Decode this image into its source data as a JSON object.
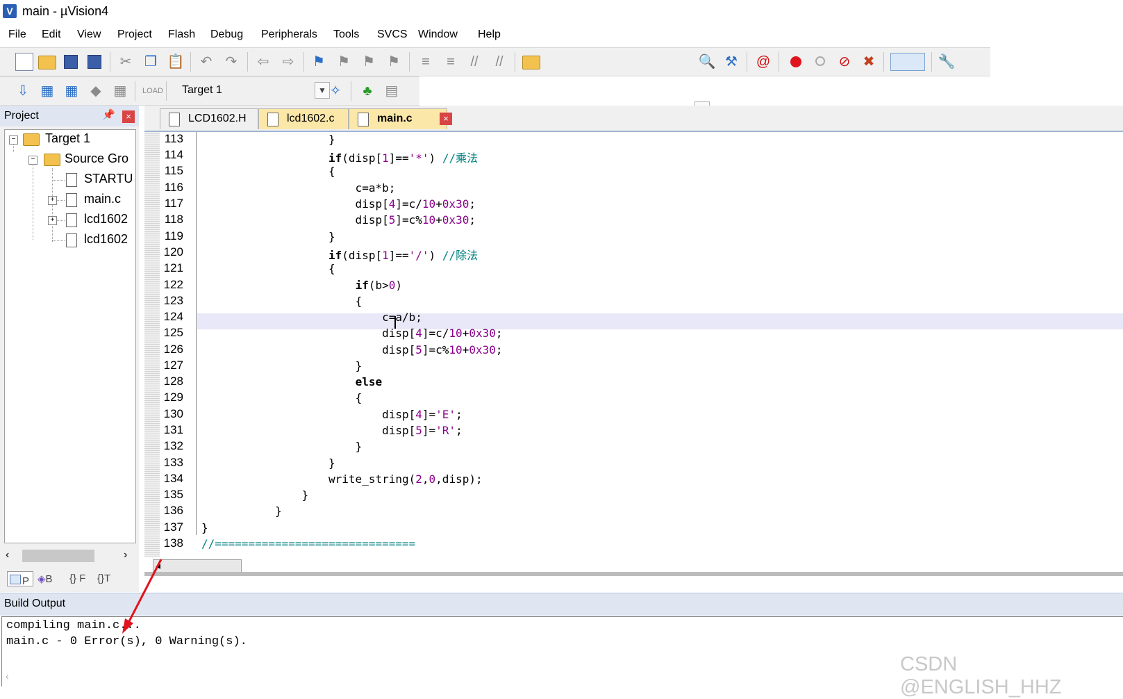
{
  "window": {
    "title": "main  - µVision4",
    "app_icon": "uvision-icon"
  },
  "menu": [
    "File",
    "Edit",
    "View",
    "Project",
    "Flash",
    "Debug",
    "Peripherals",
    "Tools",
    "SVCS",
    "Window",
    "Help"
  ],
  "toolbar2": {
    "target_label": "Target 1"
  },
  "project_panel": {
    "title": "Project",
    "tree": [
      {
        "label": "Target 1",
        "level": 0,
        "type": "target"
      },
      {
        "label": "Source Gro",
        "level": 1,
        "type": "folder"
      },
      {
        "label": "STARTU",
        "level": 2,
        "type": "file"
      },
      {
        "label": "main.c",
        "level": 2,
        "type": "file"
      },
      {
        "label": "lcd1602",
        "level": 2,
        "type": "file"
      },
      {
        "label": "lcd1602",
        "level": 2,
        "type": "file"
      }
    ],
    "tabs": [
      "P",
      "B",
      "F",
      "T"
    ]
  },
  "editor_tabs": [
    {
      "label": "LCD1602.H",
      "active": false
    },
    {
      "label": "lcd1602.c",
      "active": false
    },
    {
      "label": "main.c",
      "active": true
    }
  ],
  "code": {
    "line_numbers": [
      "113",
      "114",
      "115",
      "116",
      "117",
      "118",
      "119",
      "120",
      "121",
      "122",
      "123",
      "124",
      "125",
      "126",
      "127",
      "128",
      "129",
      "130",
      "131",
      "132",
      "133",
      "134",
      "135",
      "136",
      "137",
      "138"
    ],
    "current_line": "124"
  },
  "build_output": {
    "title": "Build Output",
    "lines": [
      "compiling main.c...",
      "main.c - 0 Error(s), 0 Warning(s)."
    ]
  },
  "watermark": "CSDN @ENGLISH_HHZ",
  "colors": {
    "accent": "#dfe6f2",
    "close": "#d94444",
    "arrow": "#e0141e",
    "current_line": "#e8e8f8"
  }
}
